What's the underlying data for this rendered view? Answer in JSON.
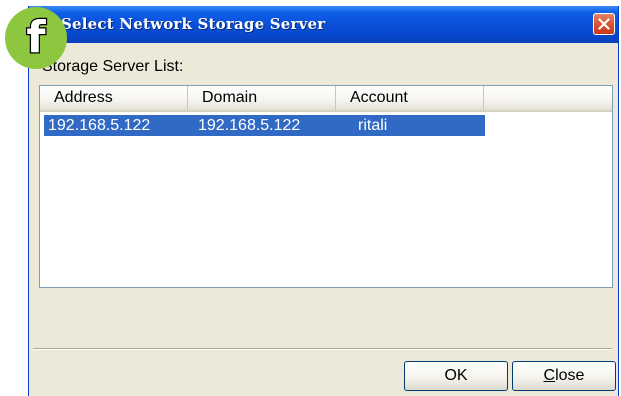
{
  "window": {
    "title": "Select Network Storage Server"
  },
  "list": {
    "label": "Storage Server List:",
    "columns": [
      "Address",
      "Domain",
      "Account"
    ],
    "rows": [
      {
        "address": "192.168.5.122",
        "domain": "192.168.5.122",
        "account": "ritali",
        "selected": true
      }
    ]
  },
  "buttons": {
    "ok": "OK",
    "close": "Close"
  },
  "badge": {
    "letter": "f",
    "color": "#8dc63f"
  },
  "icons": {
    "close": "close-icon",
    "badge": "f-badge-icon"
  },
  "colors": {
    "titlebar": "#0a4ed6",
    "selection": "#316ac5",
    "window_bg": "#ece9d8"
  }
}
